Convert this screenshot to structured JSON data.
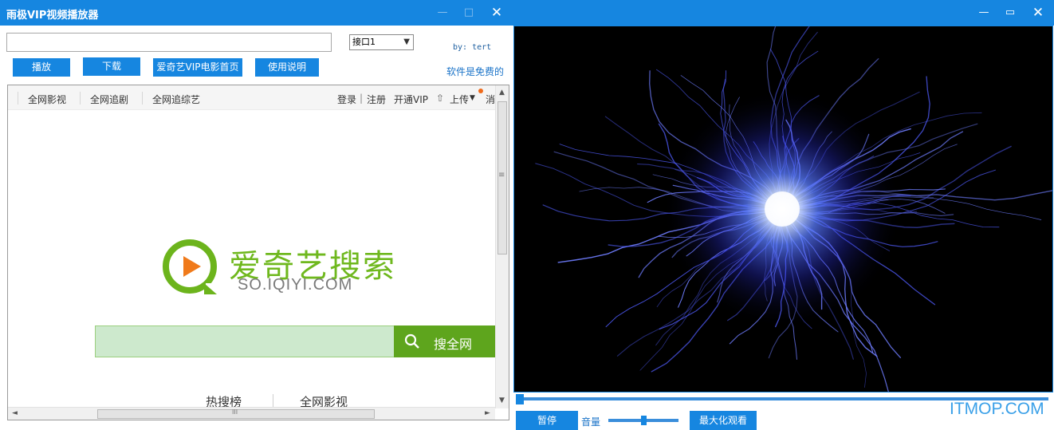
{
  "app": {
    "title": "雨极VIP视频播放器"
  },
  "controls": {
    "url_value": "",
    "interface_value": "接口1",
    "by_text": "by: tert",
    "free_text": "软件是免费的",
    "buttons": {
      "play": "播放",
      "download": "下载",
      "iqiyi_home": "爱奇艺VIP电影首页",
      "manual": "使用说明"
    }
  },
  "browser": {
    "nav_left": [
      "全网影视",
      "全网追剧",
      "全网追综艺"
    ],
    "nav_right": {
      "login": "登录",
      "sep": "|",
      "register": "注册",
      "vip": "开通VIP",
      "upload": "上传",
      "msg": "消"
    },
    "logo_title": "爱奇艺搜索",
    "logo_sub": "SO.IQIYI.COM",
    "search": {
      "value": "",
      "button": "搜全网"
    },
    "tabs": {
      "hot": "热搜榜",
      "all": "全网影视"
    },
    "scroll_grip": "≡",
    "hscroll_grip": "III"
  },
  "player": {
    "pause": "暂停",
    "volume_label": "音量",
    "volume_level": 0.47,
    "progress": 0.0,
    "maximize": "最大化观看"
  },
  "watermark": "ITMOP.COM",
  "colors": {
    "titlebar": "#1686e0",
    "green": "#5ea51d",
    "logo_orange": "#f07a1a"
  }
}
